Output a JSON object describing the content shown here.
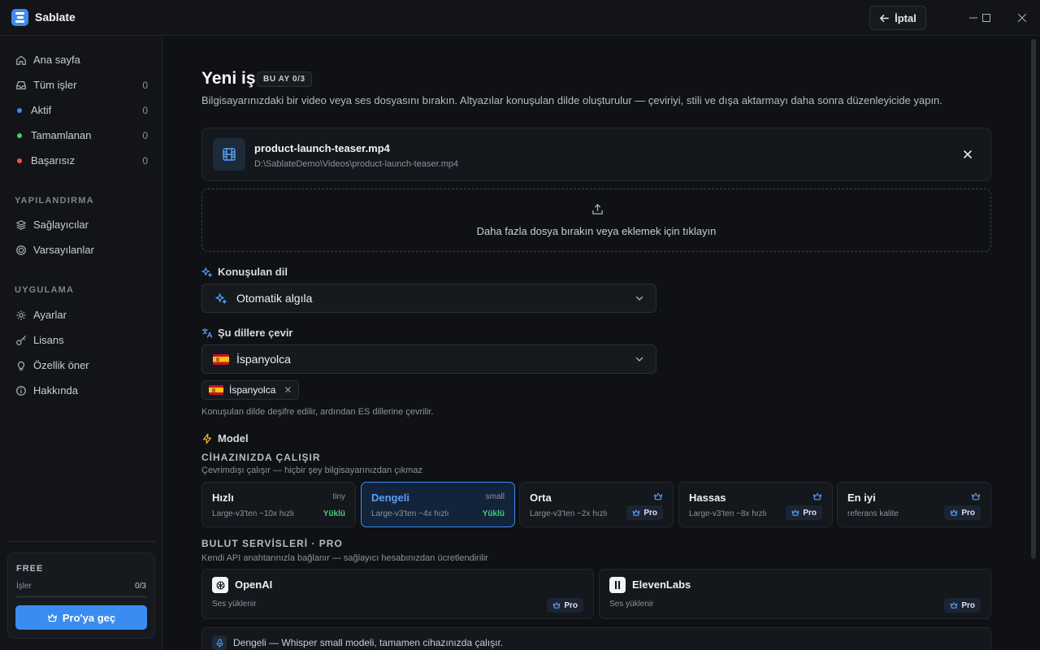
{
  "app": {
    "title": "Sablate",
    "cancel_label": "İptal"
  },
  "sidebar": {
    "items": [
      {
        "label": "Ana sayfa",
        "icon": "home-icon"
      },
      {
        "label": "Tüm işler",
        "icon": "inbox-icon",
        "count": "0"
      },
      {
        "label": "Aktif",
        "dot_color": "#3b8cf0",
        "count": "0"
      },
      {
        "label": "Tamamlanan",
        "dot_color": "#3fcf7a",
        "count": "0"
      },
      {
        "label": "Başarısız",
        "dot_color": "#f05252",
        "count": "0"
      }
    ],
    "config_label": "YAPILANDIRMA",
    "config_items": [
      {
        "label": "Sağlayıcılar",
        "icon": "layers-icon"
      },
      {
        "label": "Varsayılanlar",
        "icon": "target-icon"
      }
    ],
    "app_label": "UYGULAMA",
    "app_items": [
      {
        "label": "Ayarlar",
        "icon": "gear-icon"
      },
      {
        "label": "Lisans",
        "icon": "key-icon"
      },
      {
        "label": "Özellik öner",
        "icon": "lightbulb-icon"
      },
      {
        "label": "Hakkında",
        "icon": "info-icon"
      }
    ],
    "plan": {
      "name": "FREE",
      "jobs_label": "İşler",
      "jobs_count": "0/3",
      "jobs_fraction": 0,
      "upgrade_label": "Pro'ya geç"
    }
  },
  "main": {
    "title": "Yeni iş",
    "quota_badge": "BU AY 0/3",
    "description": "Bilgisayarınızdaki bir video veya ses dosyasını bırakın. Altyazılar konuşulan dilde oluşturulur — çeviriyi, stili ve dışa aktarmayı daha sonra düzenleyicide yapın.",
    "file": {
      "name": "product-launch-teaser.mp4",
      "path": "D:\\SablateDemo\\Videos\\product-launch-teaser.mp4"
    },
    "dropzone_text": "Daha fazla dosya bırakın veya eklemek için tıklayın",
    "spoken_language": {
      "label": "Konuşulan dil",
      "value": "Otomatik algıla"
    },
    "translate": {
      "label": "Şu dillere çevir",
      "value": "İspanyolca",
      "chips": [
        "İspanyolca"
      ],
      "hint": "Konuşulan dilde deşifre edilir, ardından ES dillerine çevrilir."
    },
    "model": {
      "label": "Model",
      "local_title": "CİHAZINIZDA ÇALIŞIR",
      "local_hint": "Çevrimdışı çalışır — hiçbir şey bilgisayarınızdan çıkmaz",
      "cards": [
        {
          "name": "Hızlı",
          "size": "tiny",
          "desc": "Large-v3'ten ~10x hızlı",
          "status": "Yüklü"
        },
        {
          "name": "Dengeli",
          "size": "small",
          "desc": "Large-v3'ten ~4x hızlı",
          "status": "Yüklü"
        },
        {
          "name": "Orta",
          "desc": "Large-v3'ten ~2x hızlı",
          "pro": "Pro"
        },
        {
          "name": "Hassas",
          "desc": "Large-v3'ten ~8x hızlı",
          "pro": "Pro"
        },
        {
          "name": "En iyi",
          "desc": "referans kalite",
          "pro": "Pro"
        }
      ],
      "cloud_title": "BULUT SERVİSLERİ · PRO",
      "cloud_hint": "Kendi API anahtarınızla bağlanır — sağlayıcı hesabınızdan ücretlendirilir",
      "cloud_cards": [
        {
          "name": "OpenAI",
          "desc": "Ses yüklenir",
          "pro": "Pro"
        },
        {
          "name": "ElevenLabs",
          "desc": "Ses yüklenir",
          "pro": "Pro"
        }
      ],
      "summary": "Dengeli — Whisper small modeli, tamamen cihazınızda çalışır."
    }
  },
  "colors": {
    "accent": "#3b8cf0",
    "success": "#3fcf7a",
    "danger": "#f05252"
  }
}
